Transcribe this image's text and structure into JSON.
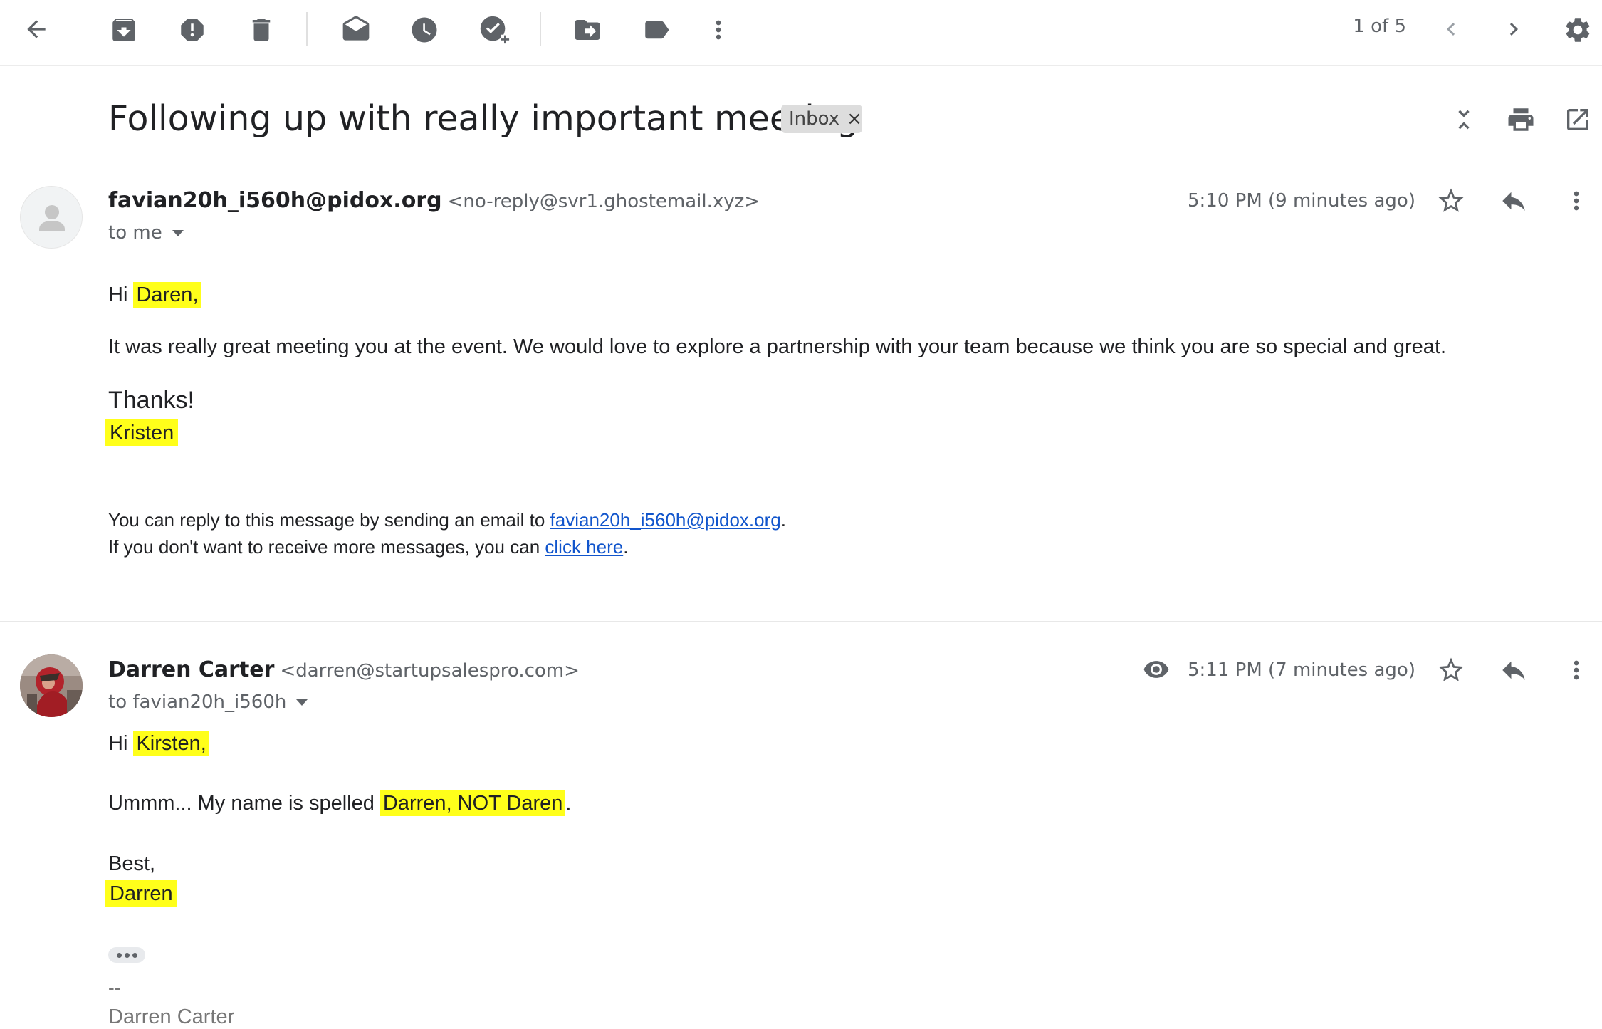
{
  "toolbar": {
    "pager": "1 of 5"
  },
  "thread": {
    "subject": "Following up with really important meeting",
    "label": "Inbox",
    "label_remove": "×"
  },
  "message1": {
    "sender_name": "favian20h_i560h@pidox.org",
    "sender_email": "<no-reply@svr1.ghostemail.xyz>",
    "to": "to me",
    "time": "5:10 PM (9 minutes ago)",
    "greeting_prefix": "Hi ",
    "greeting_name": "Daren,",
    "body": "It was really great meeting you at the event. We would love to explore a partnership with your team because we think you are so special and great.",
    "thanks": "Thanks!",
    "signature": "Kristen",
    "footer_line1_prefix": "You can reply to this message by sending an email to ",
    "footer_line1_link": "favian20h_i560h@pidox.org",
    "footer_line1_suffix": ".",
    "footer_line2_prefix": "If you don't want to receive more messages, you can ",
    "footer_line2_link": "click here",
    "footer_line2_suffix": "."
  },
  "message2": {
    "sender_name": "Darren Carter",
    "sender_email": "<darren@startupsalespro.com>",
    "to": "to favian20h_i560h",
    "time": "5:11 PM (7 minutes ago)",
    "greeting_prefix": "Hi ",
    "greeting_name": "Kirsten,",
    "body_prefix": "Ummm... My name is spelled ",
    "body_highlight": "Darren, NOT Daren",
    "body_suffix": ".",
    "closing": "Best,",
    "signature": "Darren",
    "sig_dashes": "--",
    "sig_name": "Darren Carter"
  },
  "colors": {
    "highlight": "#ffff1a",
    "link": "#1155cc",
    "icon": "#5f6368"
  }
}
